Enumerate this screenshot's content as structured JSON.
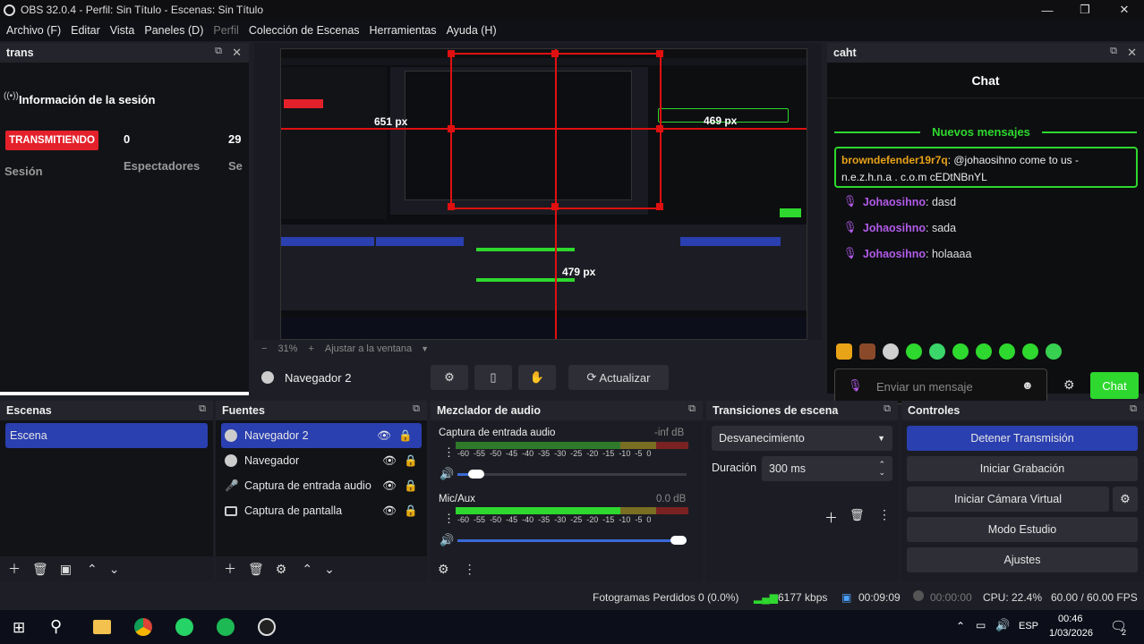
{
  "titlebar": {
    "title": "OBS 32.0.4 - Perfil: Sin Título - Escenas: Sin Título"
  },
  "menu": [
    "Archivo (F)",
    "Editar",
    "Vista",
    "Paneles (D)",
    "Perfil",
    "Colección de Escenas",
    "Herramientas",
    "Ayuda (H)"
  ],
  "trans_dock": {
    "title": "trans",
    "session_header": "Información de la sesión",
    "live_badge": "TRANSMITIENDO",
    "live_badge_color": "#e4212b",
    "viewers_value": "0",
    "third_value": "29",
    "session_label": "Sesión",
    "viewers_label": "Espectadores",
    "third_label": "Se"
  },
  "preview": {
    "measure_1": "651 px",
    "measure_2": "469 px",
    "measure_3": "479 px",
    "zoom": "31%",
    "fit": "Ajustar a la ventana"
  },
  "browser_bar": {
    "source_name": "Navegador 2",
    "refresh_label": "Actualizar"
  },
  "chat_dock": {
    "title": "caht",
    "header": "Chat",
    "new_messages": "Nuevos mensajes",
    "highlight": {
      "user": "browndefender19r7q",
      "text": ": @johaosihno come to us - n.e.z.h.n.a . c.o.m cEDtNBnYL"
    },
    "messages": [
      {
        "user": "Johaosihno",
        "text": ": dasd"
      },
      {
        "user": "Johaosihno",
        "text": ": sada"
      },
      {
        "user": "Johaosihno",
        "text": ": holaaaa"
      }
    ],
    "input_placeholder": "Enviar un mensaje",
    "send_label": "Chat",
    "accent": "#2ed82e"
  },
  "scenes": {
    "title": "Escenas",
    "items": [
      "Escena"
    ]
  },
  "sources": {
    "title": "Fuentes",
    "items": [
      {
        "label": "Navegador 2",
        "icon": "globe-icon"
      },
      {
        "label": "Navegador",
        "icon": "globe-icon"
      },
      {
        "label": "Captura de entrada audio",
        "icon": "microphone-icon"
      },
      {
        "label": "Captura de pantalla",
        "icon": "monitor-icon"
      }
    ]
  },
  "mixer": {
    "title": "Mezclador de audio",
    "channels": [
      {
        "name": "Captura de entrada audio",
        "level": "-inf dB",
        "volume": 0.05
      },
      {
        "name": "Mic/Aux",
        "level": "0.0 dB",
        "volume": 1.0
      }
    ],
    "ticks": [
      "-60",
      "-55",
      "-50",
      "-45",
      "-40",
      "-35",
      "-30",
      "-25",
      "-20",
      "-15",
      "-10",
      "-5",
      "0"
    ]
  },
  "transitions": {
    "title": "Transiciones de escena",
    "selected": "Desvanecimiento",
    "duration_label": "Duración",
    "duration_value": "300 ms"
  },
  "controls": {
    "title": "Controles",
    "buttons": [
      "Detener Transmisión",
      "Iniciar Grabación",
      "Iniciar Cámara Virtual",
      "Modo Estudio",
      "Ajustes"
    ]
  },
  "statusbar": {
    "dropped": "Fotogramas Perdidos 0 (0.0%)",
    "bitrate": "6177 kbps",
    "stream_time": "00:09:09",
    "rec_time": "00:00:00",
    "cpu": "CPU: 22.4%",
    "fps": "60.00 / 60.00 FPS"
  },
  "taskbar": {
    "lang": "ESP",
    "time": "00:46",
    "date": "1/03/2026",
    "notif_count": "2"
  }
}
